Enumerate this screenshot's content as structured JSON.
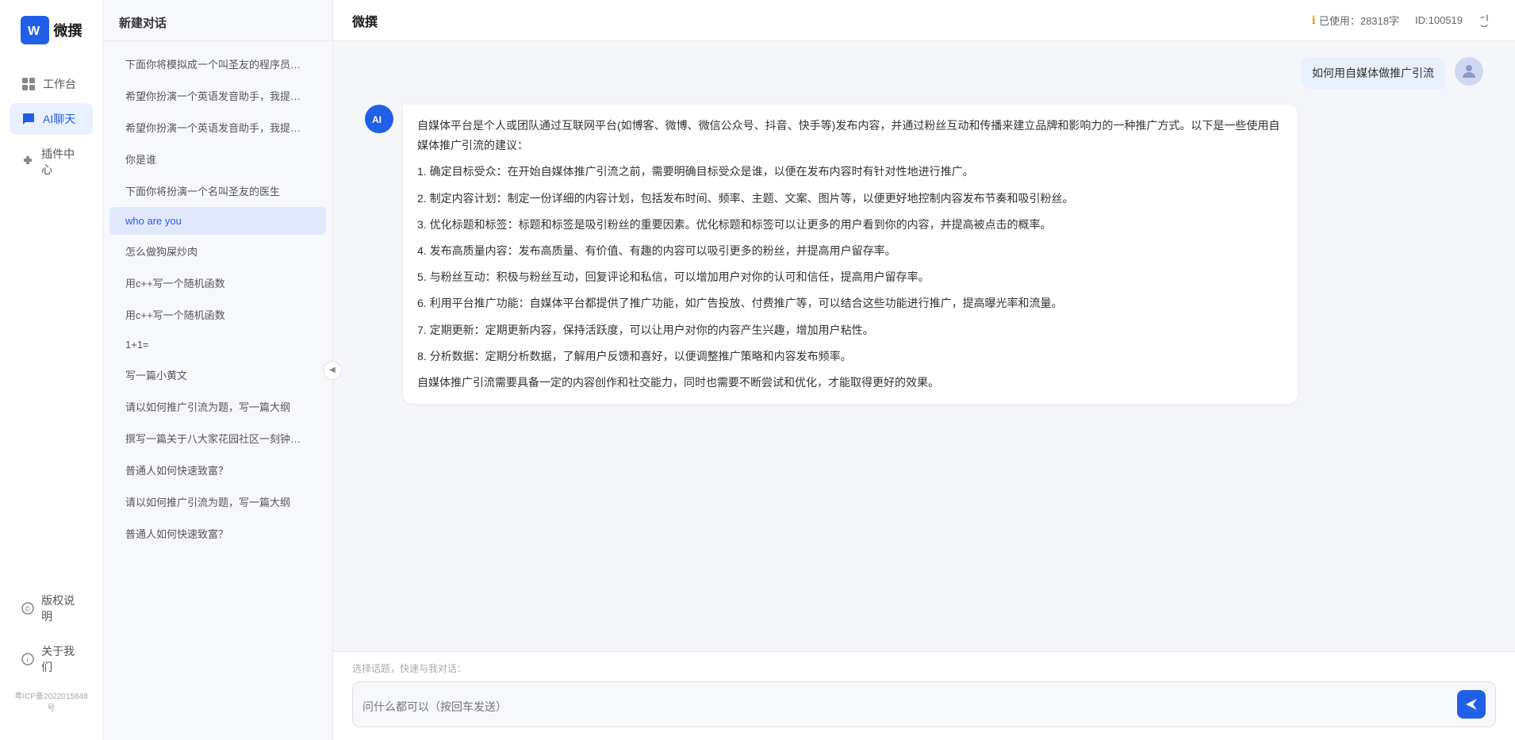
{
  "app": {
    "name": "微撰",
    "logo_letter": "W"
  },
  "header": {
    "title": "微撰",
    "usage_label": "已使用：28318字",
    "id_label": "ID:100519",
    "usage_icon": "ℹ"
  },
  "nav": {
    "items": [
      {
        "id": "workbench",
        "label": "工作台",
        "icon": "⊞"
      },
      {
        "id": "ai-chat",
        "label": "AI聊天",
        "icon": "💬",
        "active": true
      },
      {
        "id": "plugins",
        "label": "插件中心",
        "icon": "🧩"
      }
    ],
    "bottom_items": [
      {
        "id": "copyright",
        "label": "版权说明",
        "icon": "©"
      },
      {
        "id": "about",
        "label": "关于我们",
        "icon": "ℹ"
      }
    ],
    "icp": "粤ICP备2022015848号"
  },
  "sidebar": {
    "new_chat_label": "新建对话",
    "items": [
      {
        "id": 1,
        "text": "下面你将模拟成一个叫圣友的程序员，我说..."
      },
      {
        "id": 2,
        "text": "希望你扮演一个英语发音助手，我提供给你..."
      },
      {
        "id": 3,
        "text": "希望你扮演一个英语发音助手，我提供给你..."
      },
      {
        "id": 4,
        "text": "你是谁"
      },
      {
        "id": 5,
        "text": "下面你将扮演一个名叫圣友的医生"
      },
      {
        "id": 6,
        "text": "who are you",
        "active": true
      },
      {
        "id": 7,
        "text": "怎么做狗屎炒肉"
      },
      {
        "id": 8,
        "text": "用c++写一个随机函数"
      },
      {
        "id": 9,
        "text": "用c++写一个随机函数"
      },
      {
        "id": 10,
        "text": "1+1="
      },
      {
        "id": 11,
        "text": "写一篇小黄文"
      },
      {
        "id": 12,
        "text": "请以如何推广引流为题，写一篇大纲"
      },
      {
        "id": 13,
        "text": "撰写一篇关于八大家花园社区一刻钟便民生..."
      },
      {
        "id": 14,
        "text": "普通人如何快速致富？"
      },
      {
        "id": 15,
        "text": "请以如何推广引流为题，写一篇大纲"
      },
      {
        "id": 16,
        "text": "普通人如何快速致富？"
      }
    ]
  },
  "chat": {
    "user_message": "如何用自媒体做推广引流",
    "ai_response": {
      "paragraphs": [
        "自媒体平台是个人或团队通过互联网平台(如博客、微博、微信公众号、抖音、快手等)发布内容，并通过粉丝互动和传播来建立品牌和影响力的一种推广方式。以下是一些使用自媒体推广引流的建议：",
        "1. 确定目标受众：在开始自媒体推广引流之前，需要明确目标受众是谁，以便在发布内容时有针对性地进行推广。",
        "2. 制定内容计划：制定一份详细的内容计划，包括发布时间、频率、主题、文案、图片等，以便更好地控制内容发布节奏和吸引粉丝。",
        "3. 优化标题和标签：标题和标签是吸引粉丝的重要因素。优化标题和标签可以让更多的用户看到你的内容，并提高被点击的概率。",
        "4. 发布高质量内容：发布高质量、有价值、有趣的内容可以吸引更多的粉丝，并提高用户留存率。",
        "5. 与粉丝互动：积极与粉丝互动，回复评论和私信，可以增加用户对你的认可和信任，提高用户留存率。",
        "6. 利用平台推广功能：自媒体平台都提供了推广功能，如广告投放、付费推广等，可以结合这些功能进行推广，提高曝光率和流量。",
        "7. 定期更新：定期更新内容，保持活跃度，可以让用户对你的内容产生兴趣，增加用户粘性。",
        "8. 分析数据：定期分析数据，了解用户反馈和喜好，以便调整推广策略和内容发布频率。",
        "自媒体推广引流需要具备一定的内容创作和社交能力，同时也需要不断尝试和优化，才能取得更好的效果。"
      ]
    }
  },
  "input": {
    "quick_prompt_label": "选择话题，快速与我对话：",
    "placeholder": "问什么都可以（按回车发送）",
    "send_icon": "➤"
  }
}
